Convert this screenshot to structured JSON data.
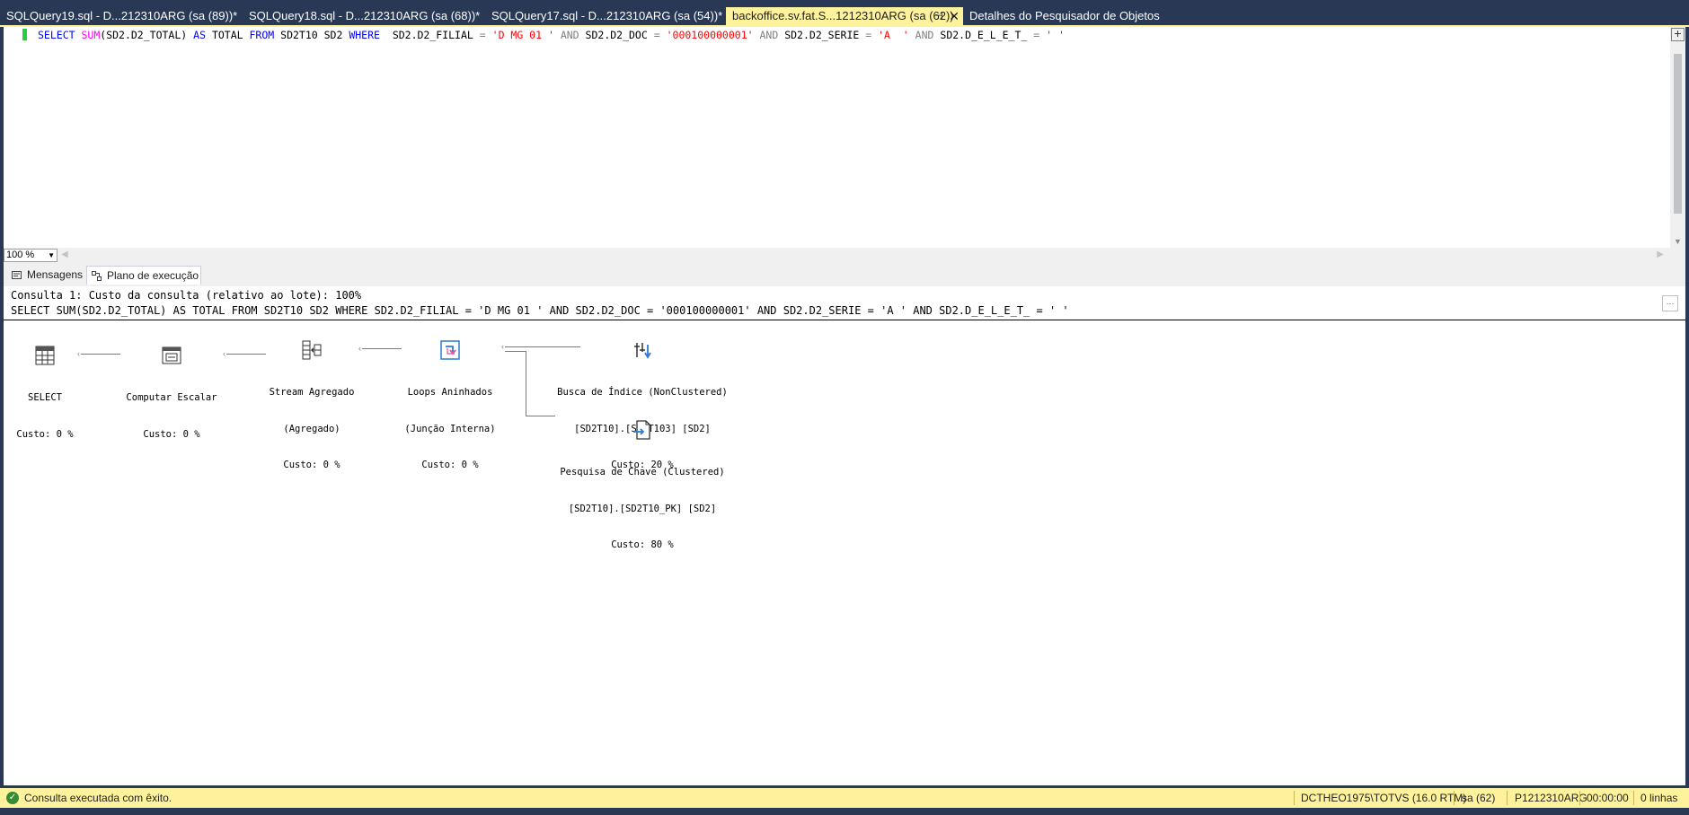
{
  "tabs": [
    {
      "label": "SQLQuery19.sql - D...212310ARG (sa (89))*"
    },
    {
      "label": "SQLQuery18.sql - D...212310ARG (sa (68))*"
    },
    {
      "label": "SQLQuery17.sql - D...212310ARG (sa (54))*"
    },
    {
      "label": "backoffice.sv.fat.S...1212310ARG (sa (62))"
    },
    {
      "label": "Detalhes do Pesquisador de Objetos"
    }
  ],
  "editor": {
    "sql_parts": {
      "p1": "SELECT",
      "p2": "SUM",
      "p3": "(SD2.D2_TOTAL)",
      "p4": "AS",
      "p5": "TOTAL",
      "p6": "FROM",
      "p7": "SD2T10 SD2",
      "p8": "WHERE",
      "p9": "SD2.D2_FILIAL",
      "p10": "=",
      "p11": "'D MG 01 '",
      "p12": "AND",
      "p13": "SD2.D2_DOC",
      "p14": "=",
      "p15": "'000100000001'",
      "p16": "AND",
      "p17": "SD2.D2_SERIE",
      "p18": "=",
      "p19": "'A  '",
      "p20": "AND",
      "p21": "SD2.D_E_L_E_T_",
      "p22": "=",
      "p23": "' '"
    },
    "zoom": "100 %"
  },
  "result_tabs": [
    {
      "label": "Mensagens"
    },
    {
      "label": "Plano de execução"
    }
  ],
  "plan": {
    "header_line1": "Consulta 1: Custo da consulta (relativo ao lote): 100%",
    "header_line2": "SELECT SUM(SD2.D2_TOTAL) AS TOTAL FROM SD2T10 SD2 WHERE SD2.D2_FILIAL = 'D MG 01 ' AND SD2.D2_DOC = '000100000001' AND SD2.D2_SERIE = 'A ' AND SD2.D_E_L_E_T_ = ' '",
    "nodes": {
      "select": {
        "label": "SELECT",
        "cost": "Custo: 0 %",
        "icon": "select-icon"
      },
      "compute_scalar": {
        "label": "Computar Escalar",
        "cost": "Custo: 0 %",
        "icon": "compute-scalar-icon"
      },
      "stream_aggregate": {
        "label": "Stream Agregado",
        "sub": "(Agregado)",
        "cost": "Custo: 0 %",
        "icon": "stream-aggregate-icon"
      },
      "nested_loops": {
        "label": "Loops Aninhados",
        "sub": "(Junção Interna)",
        "cost": "Custo: 0 %",
        "icon": "nested-loops-icon"
      },
      "index_seek": {
        "label": "Busca de Índice (NonClustered)",
        "sub": "[SD2T10].[SD2T103] [SD2]",
        "cost": "Custo: 20 %",
        "icon": "index-seek-icon"
      },
      "key_lookup": {
        "label": "Pesquisa de Chave (Clustered)",
        "sub": "[SD2T10].[SD2T10_PK] [SD2]",
        "cost": "Custo: 80 %",
        "icon": "key-lookup-icon"
      }
    }
  },
  "status": {
    "message": "Consulta executada com êxito.",
    "server": "DCTHEO1975\\TOTVS (16.0 RTM)",
    "user": "sa (62)",
    "database": "P1212310ARG",
    "elapsed": "00:00:00",
    "rows": "0 linhas"
  },
  "colors": {
    "accent": "#fff29d",
    "frame": "#293955",
    "keyword": "#0000ff",
    "function": "#ff00ff",
    "string": "#ff0000"
  }
}
